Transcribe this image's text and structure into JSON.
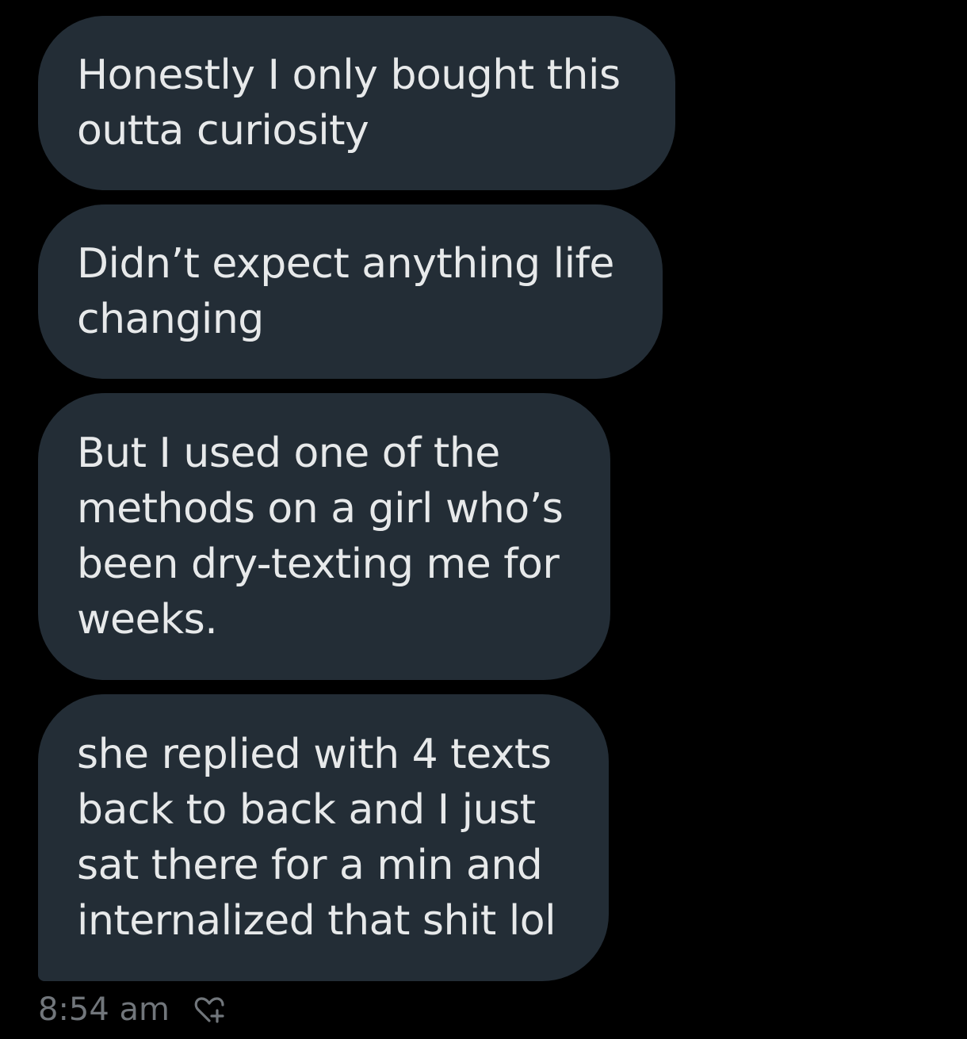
{
  "messages": [
    {
      "text": "Honestly I only bought this\noutta curiosity"
    },
    {
      "text": "Didn’t expect anything life\nchanging"
    },
    {
      "text": "But I used one of the\nmethods on a girl who’s\nbeen dry-texting me for\nweeks."
    },
    {
      "text": "she replied with 4 texts\nback to back and I just\nsat there for a min and\ninternalized that shit lol"
    }
  ],
  "footer": {
    "timestamp": "8:54 am",
    "reaction_icon": "add-reaction-heart-icon"
  },
  "colors": {
    "background": "#000000",
    "bubble": "#232d36",
    "text": "#e7e9ea",
    "meta": "#71767b"
  }
}
